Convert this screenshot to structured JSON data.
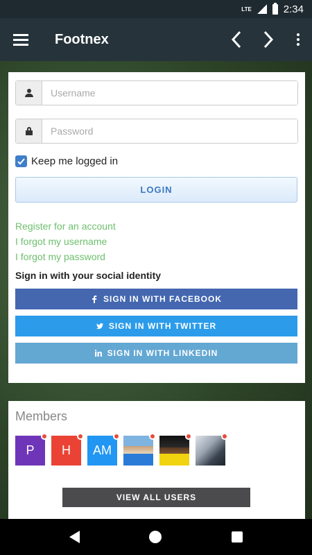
{
  "status": {
    "network": "LTE",
    "time": "2:34"
  },
  "app_bar": {
    "title": "Footnex"
  },
  "login": {
    "username_placeholder": "Username",
    "password_placeholder": "Password",
    "remember_label": "Keep me logged in",
    "remember_checked": true,
    "login_button": "LOGIN",
    "links": [
      "Register for an account",
      "I forgot my username",
      "I forgot my password"
    ],
    "social_heading": "Sign in with your social identity",
    "social": [
      {
        "label": "SIGN IN WITH FACEBOOK",
        "icon": "facebook-icon",
        "color": "#4467b0"
      },
      {
        "label": "SIGN IN WITH TWITTER",
        "icon": "twitter-icon",
        "color": "#2c9cea"
      },
      {
        "label": "SIGN IN WITH LINKEDIN",
        "icon": "linkedin-icon",
        "color": "#63a7d3"
      }
    ]
  },
  "members": {
    "title": "Members",
    "avatars": [
      {
        "initials": "P",
        "color": "#6f35b8"
      },
      {
        "initials": "H",
        "color": "#ea4335"
      },
      {
        "initials": "AM",
        "color": "#2196f3"
      },
      {
        "initials": "",
        "type": "photo"
      },
      {
        "initials": "",
        "type": "photo"
      },
      {
        "initials": "",
        "type": "photo"
      }
    ],
    "view_all": "VIEW ALL USERS"
  },
  "colors": {
    "accent": "#3f7ec9",
    "link": "#6dbf6d",
    "online_dot": "#e74c3c"
  }
}
